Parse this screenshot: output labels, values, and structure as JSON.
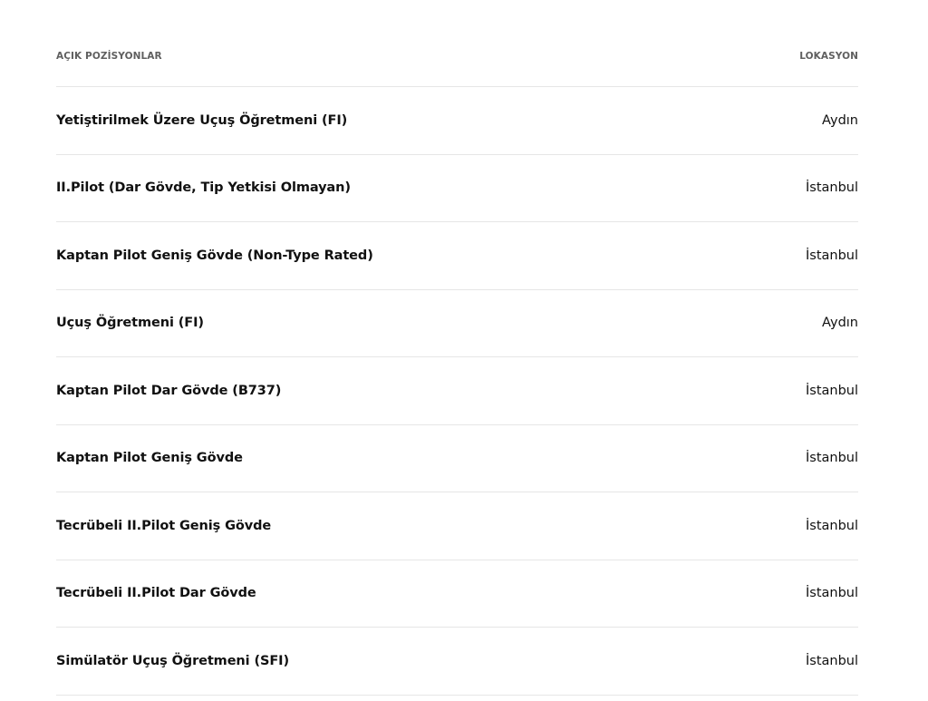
{
  "header": {
    "positions_label": "AÇIK POZİSYONLAR",
    "location_label": "LOKASYON"
  },
  "positions": [
    {
      "title": "Yetiştirilmek Üzere Uçuş Öğretmeni (FI)",
      "location": "Aydın"
    },
    {
      "title": "II.Pilot (Dar Gövde, Tip Yetkisi Olmayan)",
      "location": "İstanbul"
    },
    {
      "title": "Kaptan Pilot Geniş Gövde (Non-Type Rated)",
      "location": "İstanbul"
    },
    {
      "title": "Uçuş Öğretmeni (FI)",
      "location": "Aydın"
    },
    {
      "title": "Kaptan Pilot Dar Gövde (B737)",
      "location": "İstanbul"
    },
    {
      "title": "Kaptan Pilot Geniş Gövde",
      "location": "İstanbul"
    },
    {
      "title": "Tecrübeli II.Pilot Geniş Gövde",
      "location": "İstanbul"
    },
    {
      "title": "Tecrübeli II.Pilot Dar Gövde",
      "location": "İstanbul"
    },
    {
      "title": "Simülatör Uçuş Öğretmeni (SFI)",
      "location": "İstanbul"
    }
  ]
}
